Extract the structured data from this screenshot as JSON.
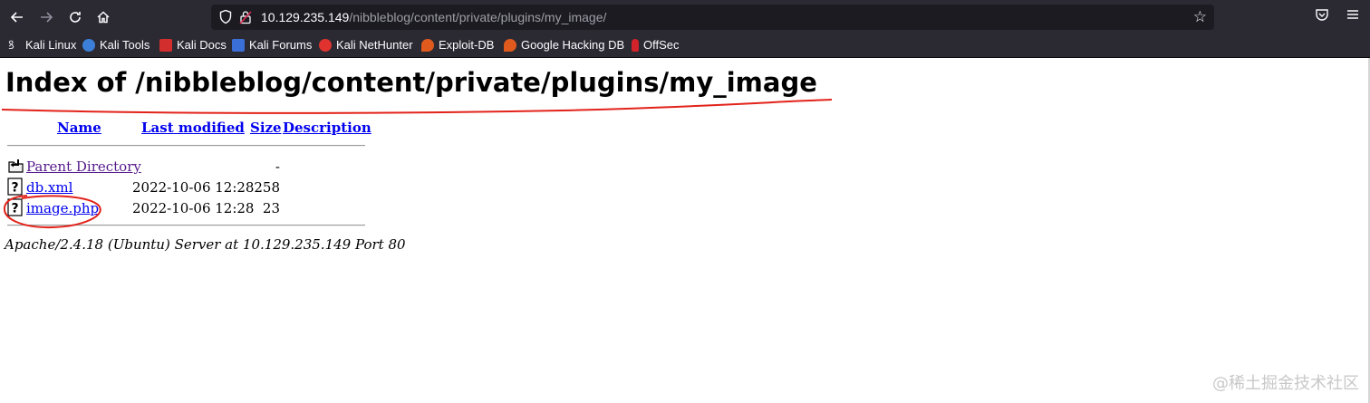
{
  "browser": {
    "url_host": "10.129.235.149",
    "url_path": "/nibbleblog/content/private/plugins/my_image/",
    "bookmarks": [
      {
        "label": "Kali Linux",
        "icon": "kali-dragon-icon",
        "color": "#d7d7db"
      },
      {
        "label": "Kali Tools",
        "icon": "kali-tools-icon",
        "color": "#3c7fd8"
      },
      {
        "label": "Kali Docs",
        "icon": "kali-docs-icon",
        "color": "#d22e2e"
      },
      {
        "label": "Kali Forums",
        "icon": "kali-forums-icon",
        "color": "#3a6fd8"
      },
      {
        "label": "Kali NetHunter",
        "icon": "nethunter-icon",
        "color": "#e0332f"
      },
      {
        "label": "Exploit-DB",
        "icon": "exploit-db-icon",
        "color": "#e05a1e"
      },
      {
        "label": "Google Hacking DB",
        "icon": "ghdb-icon",
        "color": "#e05a1e"
      },
      {
        "label": "OffSec",
        "icon": "offsec-icon",
        "color": "#d2222a"
      }
    ]
  },
  "page": {
    "heading": "Index of /nibbleblog/content/private/plugins/my_image",
    "columns": {
      "name": "Name",
      "last_modified": "Last modified",
      "size": "Size",
      "description": "Description"
    },
    "rows": [
      {
        "name": "Parent Directory",
        "modified": "",
        "size": "-",
        "icon": "back-folder-icon"
      },
      {
        "name": "db.xml",
        "modified": "2022-10-06 12:28",
        "size": "258",
        "icon": "unknown-file-icon"
      },
      {
        "name": "image.php",
        "modified": "2022-10-06 12:28",
        "size": "23",
        "icon": "unknown-file-icon"
      }
    ],
    "footer": "Apache/2.4.18 (Ubuntu) Server at 10.129.235.149 Port 80"
  },
  "watermark": "@稀土掘金技术社区",
  "colors": {
    "chrome": "#2b2a33",
    "link": "#0000ee",
    "visited": "#551a8b",
    "annotation": "#e2231a"
  }
}
